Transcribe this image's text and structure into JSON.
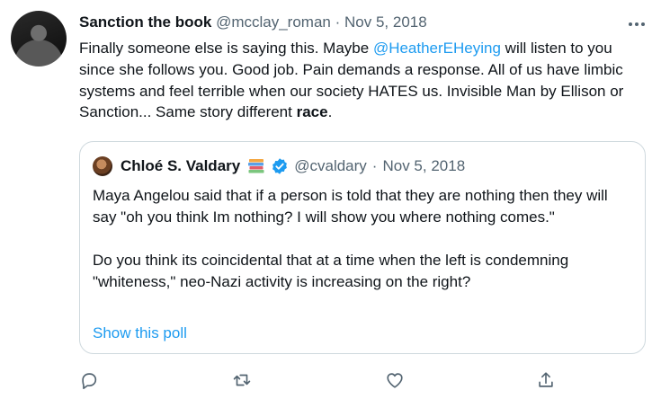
{
  "tweet": {
    "author_name": "Sanction the book",
    "author_handle": "@mcclay_roman",
    "separator": "·",
    "date": "Nov 5, 2018",
    "text_part1": "Finally someone else is saying this. Maybe ",
    "mention": "@HeatherEHeying",
    "text_part2": " will listen to you since she follows you. Good job. Pain demands a response. All of us have limbic systems and feel terrible when our society HATES us. Invisible Man by Ellison or Sanction... Same story different ",
    "text_bold": "race",
    "text_end": "."
  },
  "quote": {
    "author_name": "Chloé S. Valdary",
    "author_handle": "@cvaldary",
    "separator": "·",
    "date": "Nov 5, 2018",
    "text": "Maya Angelou said that if a person is told that they are nothing then they will say \"oh you think Im nothing? I will show you where nothing comes.\"\n\nDo you think its coincidental that at a time when the left is condemning \"whiteness,\" neo-Nazi activity is increasing on the right?",
    "poll_link": "Show this poll"
  },
  "icons": {
    "more": "more-icon",
    "reply": "reply-icon",
    "retweet": "retweet-icon",
    "like": "like-icon",
    "share": "share-icon",
    "verified": "verified-badge-icon",
    "books": "books-emoji-icon"
  },
  "colors": {
    "link": "#1d9bf0",
    "muted": "#536471",
    "border": "#cfd9de",
    "text": "#0f1419"
  }
}
